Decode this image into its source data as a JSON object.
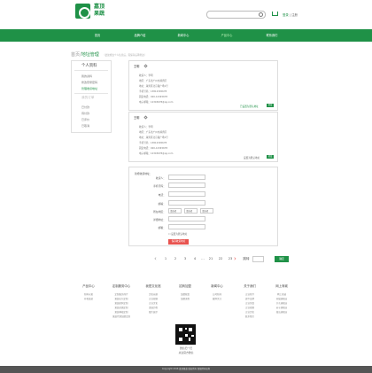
{
  "brand": {
    "line1": "嘉顶",
    "line2": "果蔬"
  },
  "search": {
    "placeholder": ""
  },
  "header": {
    "login": "登录",
    "sep": "|",
    "register": "注册"
  },
  "nav": [
    "首页",
    "品牌介绍",
    "新闻中心",
    "产品中心",
    "联系我们"
  ],
  "nav_active_index": 3,
  "breadcrumb": {
    "parent": "首页",
    "sep": "/",
    "current": "地址管理",
    "note": "（此处修改个人信息后，需保存后再修改）"
  },
  "sidebar": {
    "title": "个人资料",
    "group1": [
      "我的资料",
      "修改登录密码",
      "管理收货地址"
    ],
    "active": "管理收货地址",
    "title2": "我的订单",
    "group2": [
      "已付款",
      "待付款",
      "已评价",
      "已取消"
    ]
  },
  "addresses": [
    {
      "name": "王明",
      "lines": [
        "收货人：李明",
        "地区：广东省广州市越秀区",
        "地址：越秀区北京路广场1号",
        "手机号码：13812345678",
        "固定电话：020-12345678",
        "电子邮箱：12345678@qq.com"
      ],
      "default_text": "已设置为默认地址",
      "button": "修改"
    },
    {
      "name": "王明",
      "lines": [
        "收货人：李明",
        "地区：广东省广州市越秀区",
        "地址：越秀区北京路广场1号",
        "手机号码：13812345678",
        "固定电话：020-12345678",
        "电子邮箱：12345678@qq.com"
      ],
      "default_text": "设置为默认地址",
      "button": "修改"
    }
  ],
  "form": {
    "title": "新增收货地址：",
    "fields": [
      "收货人：",
      "手机号码：",
      "电话：",
      "邮编：",
      "所在地区：",
      "详细地址：",
      "邮箱："
    ],
    "selects": [
      "请选择",
      "请选择",
      "请选择"
    ],
    "checkbox": "设置为默认地址",
    "save": "保存收货地址"
  },
  "pager": {
    "pages": [
      "1",
      "2",
      "3",
      "4",
      "...",
      "21",
      "22",
      "23"
    ],
    "jump_label": "跳转",
    "go": "确定"
  },
  "footer": {
    "columns": [
      {
        "title": "产品中心",
        "links": [
          "新鲜水果",
          "有机蔬菜"
        ]
      },
      {
        "title": "定制服务中心",
        "links": [
          "定制服务简介",
          "果蔬礼包定制",
          "果蔬团购定制",
          "果蔬采摘定制",
          "果蔬种植定制",
          "果蔬代理加盟定制"
        ]
      },
      {
        "title": "我是文化馆",
        "links": [
          "文化长廊",
          "企业视频",
          "企业文化",
          "发展历程",
          "图片展示"
        ]
      },
      {
        "title": "招商加盟",
        "links": [
          "加盟政策",
          "加盟流程"
        ]
      },
      {
        "title": "新闻中心",
        "links": [
          "公司新闻",
          "媒体关注"
        ]
      },
      {
        "title": "关于我们",
        "links": [
          "企业简介",
          "旗下品牌",
          "企业荣誉",
          "企业视频",
          "企业文化",
          "联系我们"
        ]
      },
      {
        "title": "网上商城",
        "links": [
          "网上商城",
          "天猫旗舰店",
          "京东旗舰店",
          "苏宁旗舰店",
          "微店旗舰店"
        ]
      }
    ],
    "qr_caption1": "微信扫一扫",
    "qr_caption2": "关注官方微信",
    "copyright": "Copyright 2016 嘉顶果蔬 版权所有 保留所有权利"
  },
  "colors": {
    "brand_green": "#1f9147",
    "save_red": "#e8534f"
  }
}
